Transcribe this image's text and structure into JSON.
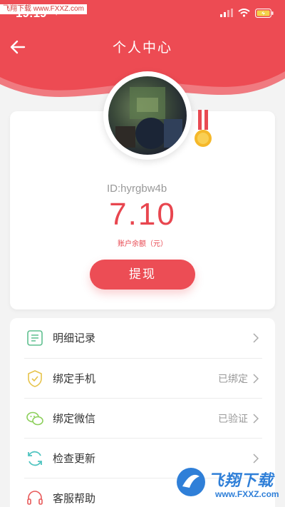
{
  "status_bar": {
    "time": "19:19"
  },
  "watermark_top": "飞翔下载 www.FXXZ.com",
  "nav": {
    "title": "个人中心"
  },
  "profile": {
    "user_id": "ID:hyrgbw4b",
    "balance": "7.10",
    "balance_label": "账户余额（元）",
    "withdraw_label": "提现"
  },
  "menu": {
    "items": [
      {
        "label": "明细记录",
        "status": "",
        "icon": "list-document-icon"
      },
      {
        "label": "绑定手机",
        "status": "已绑定",
        "icon": "shield-check-icon"
      },
      {
        "label": "绑定微信",
        "status": "已验证",
        "icon": "wechat-icon"
      },
      {
        "label": "检查更新",
        "status": "",
        "icon": "refresh-icon"
      },
      {
        "label": "客服帮助",
        "status": "",
        "icon": "headset-icon"
      }
    ]
  },
  "watermark_bottom": {
    "brand": "飞翔下载",
    "url": "www.FXXZ.com"
  },
  "colors": {
    "accent": "#ec4d55",
    "header": "#ee4a52",
    "balance": "#e8464f"
  }
}
